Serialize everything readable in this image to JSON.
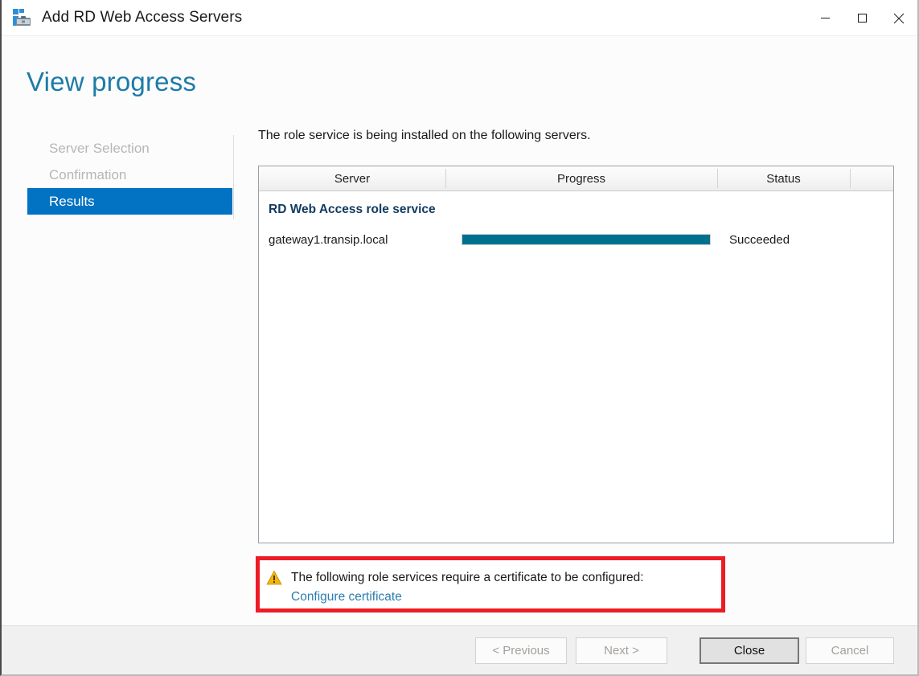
{
  "window": {
    "title": "Add RD Web Access Servers",
    "icon": "server-manager-icon",
    "controls": {
      "minimize": "minimize-icon",
      "maximize": "maximize-icon",
      "close": "close-icon"
    }
  },
  "page": {
    "heading": "View progress"
  },
  "nav": {
    "items": [
      {
        "label": "Server Selection",
        "state": "visited"
      },
      {
        "label": "Confirmation",
        "state": "visited"
      },
      {
        "label": "Results",
        "state": "active"
      }
    ]
  },
  "main": {
    "description": "The role service is being installed on the following servers.",
    "table": {
      "columns": [
        "Server",
        "Progress",
        "Status",
        ""
      ],
      "groups": [
        {
          "title": "RD Web Access role service",
          "rows": [
            {
              "server": "gateway1.transip.local",
              "progress": 100,
              "status": "Succeeded"
            }
          ]
        }
      ]
    }
  },
  "warning": {
    "icon": "warning-triangle-icon",
    "message": "The following role services require a certificate to be configured:",
    "link": "Configure certificate",
    "highlight_color": "#ed1c24"
  },
  "footer": {
    "buttons": [
      {
        "label": "< Previous",
        "enabled": false
      },
      {
        "label": "Next >",
        "enabled": false
      },
      {
        "label": "Close",
        "enabled": true
      },
      {
        "label": "Cancel",
        "enabled": false
      }
    ]
  },
  "colors": {
    "accent": "#0272c3",
    "heading": "#1c7ba8",
    "progress": "#00708f",
    "group_title": "#123a5e",
    "link": "#2b7cb0"
  }
}
